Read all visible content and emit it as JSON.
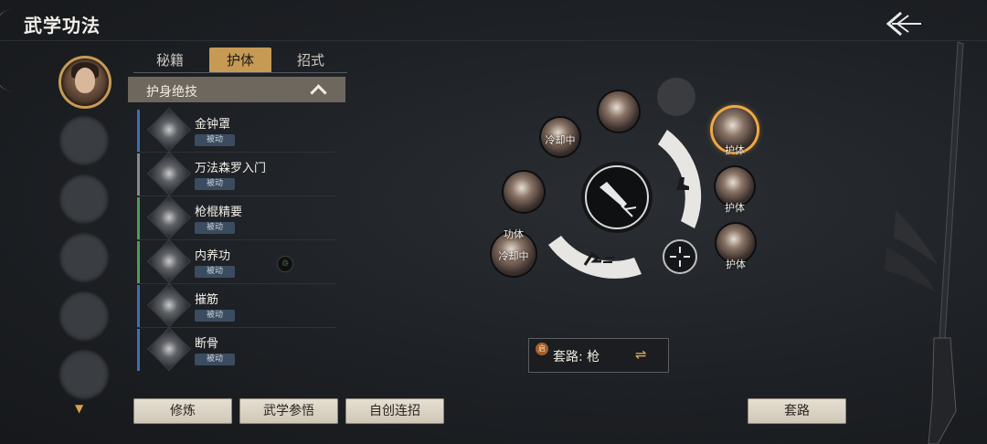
{
  "header": {
    "title": "武学功法"
  },
  "tabs": [
    {
      "label": "秘籍"
    },
    {
      "label": "护体"
    },
    {
      "label": "招式"
    }
  ],
  "section": {
    "title": "护身绝技"
  },
  "skills": [
    {
      "name": "金钟罩",
      "tag": "被动",
      "color": "#3f6fb5"
    },
    {
      "name": "万法森罗入门",
      "tag": "被动",
      "color": "#8a8a8a"
    },
    {
      "name": "枪棍精要",
      "tag": "被动",
      "color": "#4f9c5a"
    },
    {
      "name": "内养功",
      "tag": "被动",
      "color": "#4f9c5a"
    },
    {
      "name": "摧筋",
      "tag": "被动",
      "color": "#3f6fb5"
    },
    {
      "name": "断骨",
      "tag": "被动",
      "color": "#3f6fb5"
    }
  ],
  "buttons": {
    "practice": "修炼",
    "comprehend": "武学参悟",
    "custom_combo": "自创连招",
    "routine": "套路"
  },
  "wheel": {
    "cooldown1": "冷却中",
    "gongti": "功体",
    "cooldown2": "冷却中",
    "huti1": "护体",
    "huti2": "护体",
    "huti3": "护体"
  },
  "routine": {
    "badge": "启",
    "label": "套路: 枪",
    "swap_icon": "⇌"
  },
  "colors": {
    "accent": "#c69a55",
    "selected_ring": "#f0a844"
  }
}
